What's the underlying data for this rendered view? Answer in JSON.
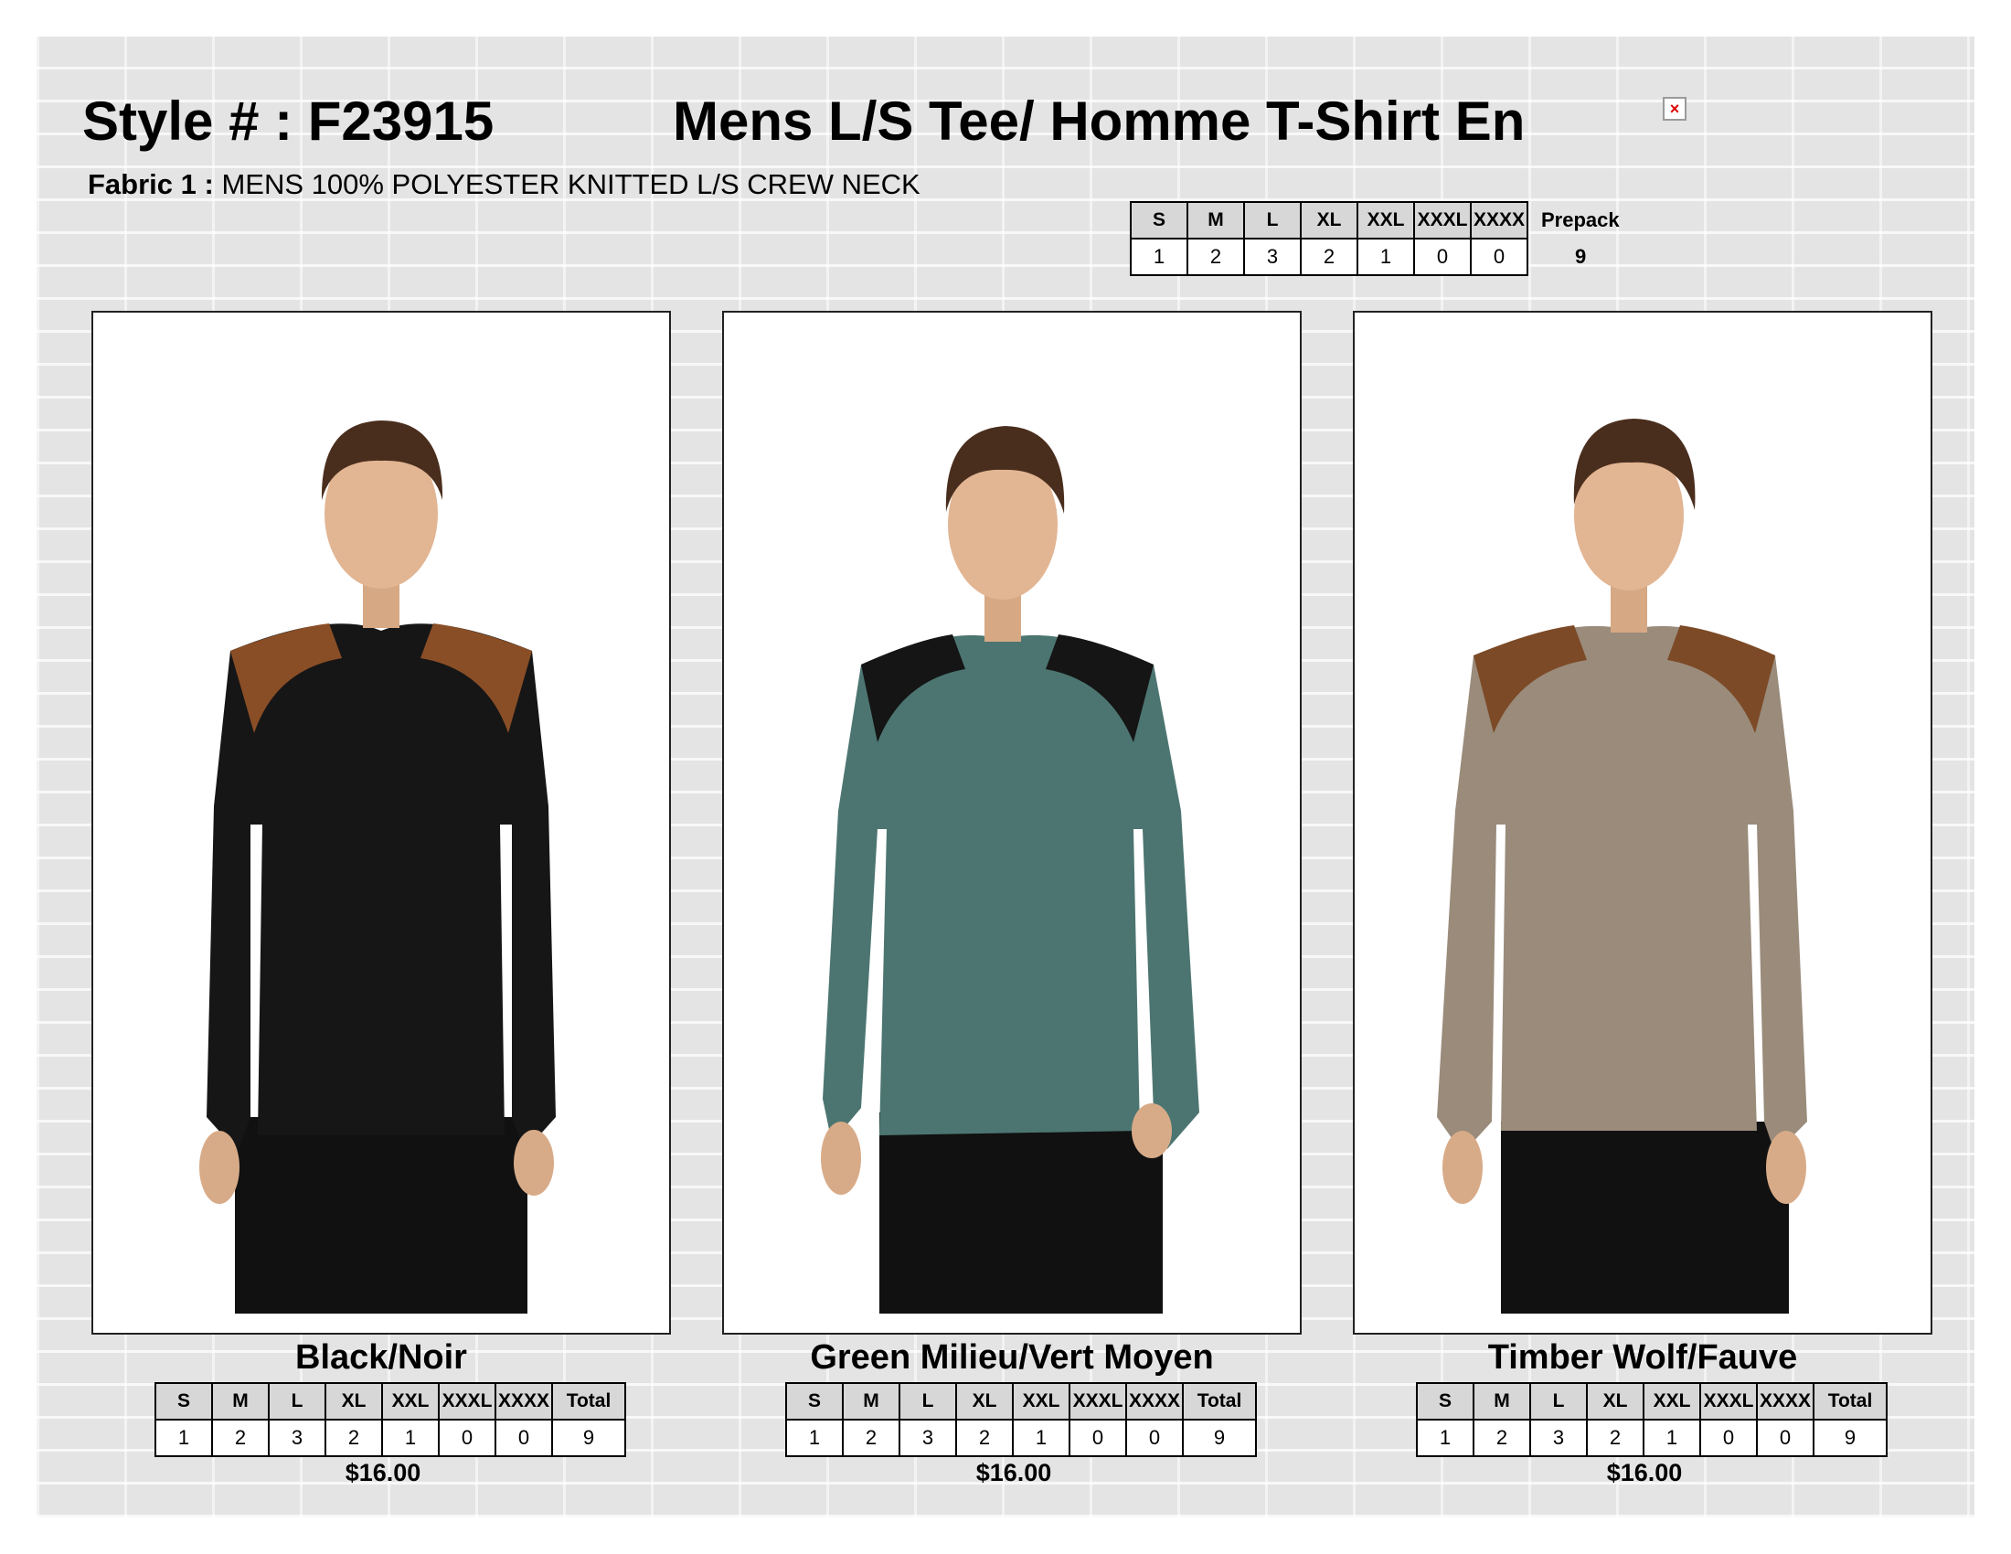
{
  "header": {
    "style_label": "Style # : F23915",
    "product_title": "Mens L/S  Tee/ Homme T-Shirt En",
    "fabric_label": "Fabric 1 :",
    "fabric_value": "MENS 100% POLYESTER KNITTED L/S CREW NECK"
  },
  "prepack": {
    "sizes": [
      "S",
      "M",
      "L",
      "XL",
      "XXL",
      "XXXL",
      "XXXX"
    ],
    "quantities": [
      "1",
      "2",
      "3",
      "2",
      "1",
      "0",
      "0"
    ],
    "label": "Prepack",
    "total": "9"
  },
  "products": [
    {
      "color": "Black/Noir",
      "price": "$16.00",
      "body_color": "#161616",
      "shoulder_color": "#8a4e26",
      "sizes": [
        "S",
        "M",
        "L",
        "XL",
        "XXL",
        "XXXL",
        "XXXX"
      ],
      "total_label": "Total",
      "quantities": [
        "1",
        "2",
        "3",
        "2",
        "1",
        "0",
        "0"
      ],
      "total": "9"
    },
    {
      "color": "Green Milieu/Vert Moyen",
      "price": "$16.00",
      "body_color": "#4c7571",
      "shoulder_color": "#151515",
      "sizes": [
        "S",
        "M",
        "L",
        "XL",
        "XXL",
        "XXXL",
        "XXXX"
      ],
      "total_label": "Total",
      "quantities": [
        "1",
        "2",
        "3",
        "2",
        "1",
        "0",
        "0"
      ],
      "total": "9"
    },
    {
      "color": "Timber Wolf/Fauve",
      "price": "$16.00",
      "body_color": "#9a8b7b",
      "shoulder_color": "#7c4a27",
      "sizes": [
        "S",
        "M",
        "L",
        "XL",
        "XXL",
        "XXXL",
        "XXXX"
      ],
      "total_label": "Total",
      "quantities": [
        "1",
        "2",
        "3",
        "2",
        "1",
        "0",
        "0"
      ],
      "total": "9"
    }
  ]
}
